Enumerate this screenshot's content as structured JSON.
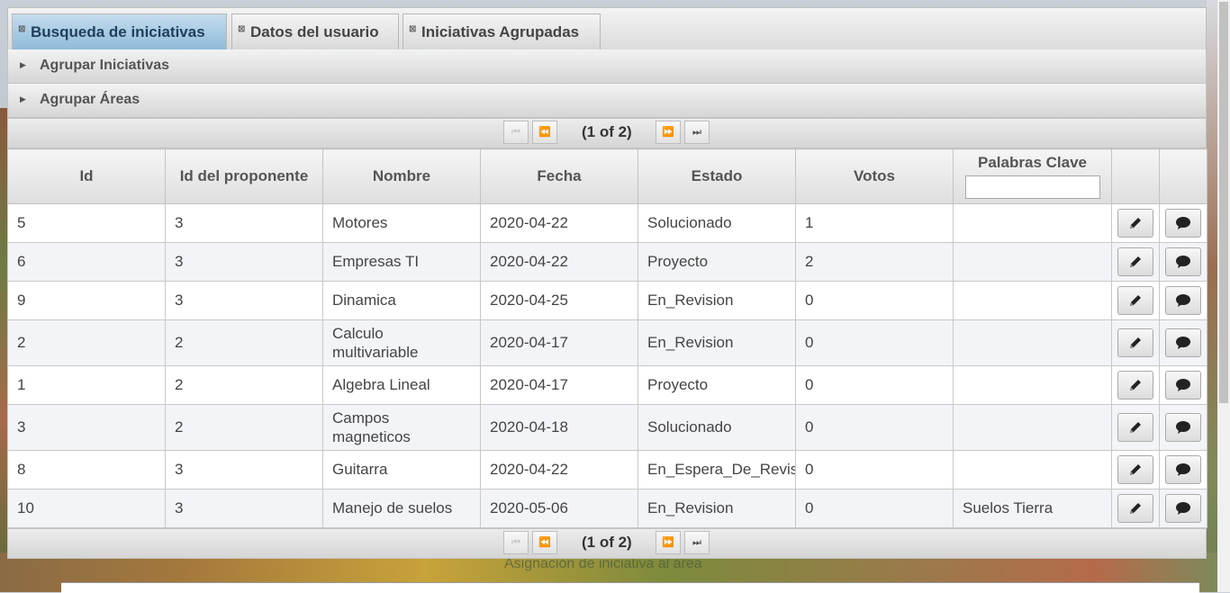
{
  "tabs": [
    {
      "label": "Busqueda de iniciativas",
      "active": true
    },
    {
      "label": "Datos del usuario",
      "active": false
    },
    {
      "label": "Iniciativas Agrupadas",
      "active": false
    }
  ],
  "accordion": [
    {
      "label": "Agrupar Iniciativas"
    },
    {
      "label": "Agrupar Áreas"
    }
  ],
  "paginator": {
    "current": "(1 of 2)"
  },
  "table": {
    "headers": [
      "Id",
      "Id del proponente",
      "Nombre",
      "Fecha",
      "Estado",
      "Votos",
      "Palabras Clave",
      "",
      ""
    ],
    "filter_value": "",
    "rows": [
      {
        "id": "5",
        "proponente": "3",
        "nombre": "Motores",
        "fecha": "2020-04-22",
        "estado": "Solucionado",
        "votos": "1",
        "palabras": ""
      },
      {
        "id": "6",
        "proponente": "3",
        "nombre": "Empresas TI",
        "fecha": "2020-04-22",
        "estado": "Proyecto",
        "votos": "2",
        "palabras": ""
      },
      {
        "id": "9",
        "proponente": "3",
        "nombre": "Dinamica",
        "fecha": "2020-04-25",
        "estado": "En_Revision",
        "votos": "0",
        "palabras": ""
      },
      {
        "id": "2",
        "proponente": "2",
        "nombre": "Calculo multivariable",
        "fecha": "2020-04-17",
        "estado": "En_Revision",
        "votos": "0",
        "palabras": ""
      },
      {
        "id": "1",
        "proponente": "2",
        "nombre": "Algebra Lineal",
        "fecha": "2020-04-17",
        "estado": "Proyecto",
        "votos": "0",
        "palabras": ""
      },
      {
        "id": "3",
        "proponente": "2",
        "nombre": "Campos magneticos",
        "fecha": "2020-04-18",
        "estado": "Solucionado",
        "votos": "0",
        "palabras": ""
      },
      {
        "id": "8",
        "proponente": "3",
        "nombre": "Guitarra",
        "fecha": "2020-04-22",
        "estado": "En_Espera_De_Revision",
        "votos": "0",
        "palabras": ""
      },
      {
        "id": "10",
        "proponente": "3",
        "nombre": "Manejo de suelos",
        "fecha": "2020-05-06",
        "estado": "En_Revision",
        "votos": "0",
        "palabras": "Suelos Tierra"
      }
    ]
  },
  "background_caption": "Asignación de iniciativa al área",
  "icons": {
    "edit": "pencil-icon",
    "comment": "comment-icon"
  }
}
